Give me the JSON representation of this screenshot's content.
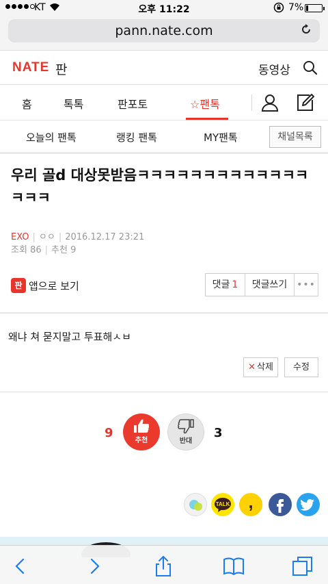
{
  "status_bar": {
    "carrier": "KT",
    "time": "오후 11:22",
    "battery_percent": "7%",
    "battery_level": 0.07
  },
  "browser": {
    "url": "pann.nate.com"
  },
  "site_header": {
    "logo": "NATE",
    "section": "판",
    "video_link": "동영상"
  },
  "main_nav": {
    "tabs": [
      {
        "label": "홈"
      },
      {
        "label": "톡톡"
      },
      {
        "label": "판포토"
      },
      {
        "label": "☆팬톡",
        "active": true
      }
    ]
  },
  "sub_nav": {
    "tabs": [
      {
        "label": "오늘의 팬톡"
      },
      {
        "label": "랭킹 팬톡"
      },
      {
        "label": "MY팬톡"
      }
    ],
    "channel_button": "채널목록"
  },
  "article": {
    "title": "우리 골d 대상못받음ㅋㅋㅋㅋㅋㅋㅋㅋㅋㅋㅋㅋㅋㅋㅋㅋ",
    "category": "EXO",
    "author": "ㅇㅇ",
    "datetime": "2016.12.17 23:21",
    "views_label": "조회",
    "views": "86",
    "recommend_label": "추천",
    "recommend": "9",
    "app_view_icon": "판",
    "app_view_label": "앱으로 보기",
    "comment_label": "댓글",
    "comment_count": "1",
    "write_comment_label": "댓글쓰기",
    "more_label": "•••",
    "body": "왜냐 쳐 묻지말고 투표해ㅅㅂ",
    "delete_label": "삭제",
    "edit_label": "수정"
  },
  "vote": {
    "up_count": "9",
    "up_label": "추천",
    "down_label": "반대",
    "down_count": "3"
  },
  "share": {
    "kakaotalk_label": "TALK",
    "kakaostory_label": ","
  },
  "colors": {
    "accent": "#e8352c",
    "facebook": "#3b5998",
    "twitter": "#2aa3ef",
    "kakao": "#fee500"
  }
}
